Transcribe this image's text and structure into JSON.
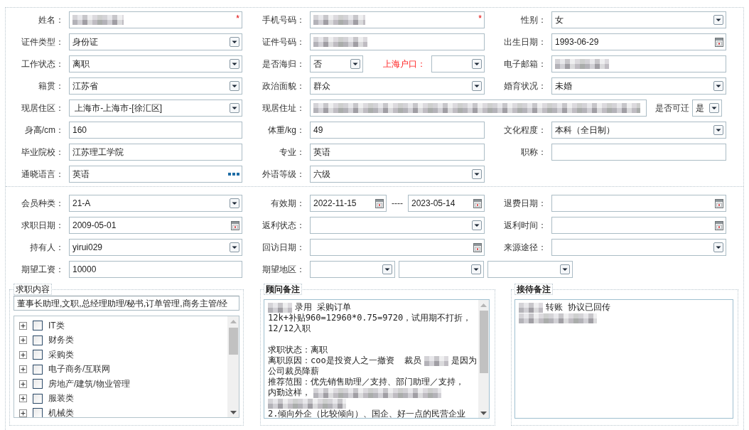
{
  "personal": {
    "rows": [
      {
        "cells": [
          {
            "label": "姓名：",
            "controls": [
              {
                "kind": "text",
                "redacted": true,
                "mark": "*"
              }
            ]
          },
          {
            "label": "手机号码：",
            "controls": [
              {
                "kind": "text",
                "redacted": true,
                "mark": "*"
              }
            ]
          },
          {
            "label": "性别：",
            "controls": [
              {
                "kind": "select",
                "value": "女"
              }
            ]
          }
        ]
      },
      {
        "cells": [
          {
            "label": "证件类型：",
            "controls": [
              {
                "kind": "select",
                "value": "身份证"
              }
            ]
          },
          {
            "label": "证件号码：",
            "controls": [
              {
                "kind": "text",
                "redacted": true
              }
            ]
          },
          {
            "label": "出生日期：",
            "controls": [
              {
                "kind": "date",
                "value": "1993-06-29"
              }
            ]
          }
        ]
      },
      {
        "cells": [
          {
            "label": "工作状态：",
            "controls": [
              {
                "kind": "select",
                "value": "离职"
              }
            ]
          },
          {
            "label": "是否海归：",
            "controls": [
              {
                "kind": "select",
                "value": "否"
              }
            ],
            "extra": {
              "label": "上海户口：",
              "emphasized": true,
              "controls": [
                {
                  "kind": "select"
                }
              ]
            }
          },
          {
            "label": "电子邮箱：",
            "controls": [
              {
                "kind": "text",
                "redacted": true
              }
            ]
          }
        ]
      },
      {
        "cells": [
          {
            "label": "籍贯：",
            "controls": [
              {
                "kind": "select",
                "value": "江苏省"
              }
            ]
          },
          {
            "label": "政治面貌：",
            "controls": [
              {
                "kind": "select",
                "value": "群众"
              }
            ]
          },
          {
            "label": "婚育状况：",
            "controls": [
              {
                "kind": "select",
                "value": "未婚"
              }
            ]
          }
        ]
      },
      {
        "cells": [
          {
            "label": "现居住区：",
            "controls": [
              {
                "kind": "select",
                "value": " 上海市-上海市-[徐汇区]"
              }
            ]
          },
          {
            "label": "现居住址：",
            "controls": [
              {
                "kind": "text",
                "redacted": true
              }
            ],
            "extra": {
              "label": "是否可迁",
              "emphasized": false,
              "controls": [
                {
                  "kind": "select",
                  "value": "是"
                }
              ]
            }
          }
        ]
      },
      {
        "cells": [
          {
            "label": "身高/cm：",
            "controls": [
              {
                "kind": "text",
                "value": "160"
              }
            ]
          },
          {
            "label": "体重/kg：",
            "controls": [
              {
                "kind": "text",
                "value": "49"
              }
            ]
          },
          {
            "label": "文化程度：",
            "controls": [
              {
                "kind": "select",
                "value": "本科（全日制）"
              }
            ]
          }
        ]
      },
      {
        "cells": [
          {
            "label": "毕业院校：",
            "controls": [
              {
                "kind": "text",
                "value": "江苏理工学院"
              }
            ]
          },
          {
            "label": "专业：",
            "controls": [
              {
                "kind": "text",
                "value": "英语"
              }
            ]
          },
          {
            "label": "职称：",
            "controls": [
              {
                "kind": "text"
              }
            ]
          }
        ]
      },
      {
        "cells": [
          {
            "label": "通晓语言：",
            "controls": [
              {
                "kind": "lookup",
                "value": "英语"
              }
            ]
          },
          {
            "label": "外语等级：",
            "controls": [
              {
                "kind": "select",
                "value": "六级"
              }
            ]
          }
        ]
      }
    ]
  },
  "membership": {
    "rows": [
      {
        "cells": [
          {
            "label": "会员种类：",
            "controls": [
              {
                "kind": "select",
                "value": "21-A"
              }
            ]
          },
          {
            "label": "有效期：",
            "joiner": "----",
            "controls": [
              {
                "kind": "date",
                "value": "2022-11-15"
              },
              {
                "kind": "date",
                "value": "2023-05-14"
              }
            ]
          },
          {
            "label": "退费日期：",
            "controls": [
              {
                "kind": "date"
              }
            ]
          }
        ]
      },
      {
        "cells": [
          {
            "label": "求职日期：",
            "controls": [
              {
                "kind": "date",
                "value": "2009-05-01"
              }
            ]
          },
          {
            "label": "返利状态：",
            "controls": [
              {
                "kind": "select"
              }
            ]
          },
          {
            "label": "返利时间：",
            "controls": [
              {
                "kind": "date"
              }
            ]
          }
        ]
      },
      {
        "cells": [
          {
            "label": "持有人：",
            "controls": [
              {
                "kind": "select",
                "value": "yirui029"
              }
            ]
          },
          {
            "label": "回访日期：",
            "controls": [
              {
                "kind": "date"
              }
            ]
          },
          {
            "label": "来源途径：",
            "controls": [
              {
                "kind": "select"
              }
            ]
          }
        ]
      },
      {
        "cells": [
          {
            "label": "期望工资：",
            "controls": [
              {
                "kind": "text",
                "value": "10000"
              }
            ]
          },
          {
            "label": "期望地区：",
            "controls": [
              {
                "kind": "select"
              },
              {
                "kind": "select"
              },
              {
                "kind": "select"
              }
            ]
          }
        ]
      }
    ]
  },
  "groups": [
    {
      "kind": "selector",
      "title": "求职内容",
      "summary": "董事长助理,文职,总经理助理/秘书,订单管理,商务主管/经",
      "categories": [
        {
          "label": "IT类",
          "expanded": false,
          "checked": false
        },
        {
          "label": "财务类",
          "expanded": false,
          "checked": false
        },
        {
          "label": "采购类",
          "expanded": false,
          "checked": false
        },
        {
          "label": "电子商务/互联网",
          "expanded": false,
          "checked": false
        },
        {
          "label": "房地产/建筑/物业管理",
          "expanded": false,
          "checked": false
        },
        {
          "label": "服装类",
          "expanded": false,
          "checked": false
        },
        {
          "label": "机械类",
          "expanded": false,
          "checked": false
        }
      ]
    },
    {
      "kind": "notes",
      "title": "顾问备注",
      "paragraphs": [
        {
          "lines": [
            {
              "parts": [
                {
                  "kind": "mosaic"
                },
                {
                  "kind": "text",
                  "text": "录用 采购订单"
                }
              ]
            },
            {
              "parts": [
                {
                  "kind": "text",
                  "text": "12k+补贴960=12960*0.75=9720，试用期不打折，"
                }
              ]
            },
            {
              "parts": [
                {
                  "kind": "text",
                  "text": "12/12入职"
                }
              ]
            }
          ]
        },
        {
          "lines": [
            {
              "parts": [
                {
                  "kind": "text",
                  "text": "求职状态：离职"
                }
              ]
            },
            {
              "parts": [
                {
                  "kind": "text",
                  "text": "离职原因：coo是投资人之一撤资  裁员"
                },
                {
                  "kind": "mosaic"
                },
                {
                  "kind": "text",
                  "text": "是因为"
                }
              ]
            },
            {
              "parts": [
                {
                  "kind": "text",
                  "text": "公司裁员降薪"
                }
              ]
            },
            {
              "parts": [
                {
                  "kind": "text",
                  "text": "推荐范围：优先销售助理／支持、部门助理／支持，"
                }
              ]
            },
            {
              "parts": [
                {
                  "kind": "text",
                  "text": "内勤这样，"
                },
                {
                  "kind": "mosaic"
                }
              ]
            },
            {
              "parts": [
                {
                  "kind": "mosaic"
                }
              ]
            },
            {
              "parts": [
                {
                  "kind": "text",
                  "text": "2.倾向外企（比较倾向）、国企、好一点的民营企业"
                }
              ]
            }
          ]
        }
      ]
    },
    {
      "kind": "notes",
      "title": "接待备注",
      "paragraphs": [
        {
          "lines": [
            {
              "parts": [
                {
                  "kind": "mosaic"
                },
                {
                  "kind": "text",
                  "text": "转账 协议已回传"
                }
              ]
            },
            {
              "parts": [
                {
                  "kind": "mosaic"
                }
              ]
            }
          ]
        }
      ]
    }
  ]
}
